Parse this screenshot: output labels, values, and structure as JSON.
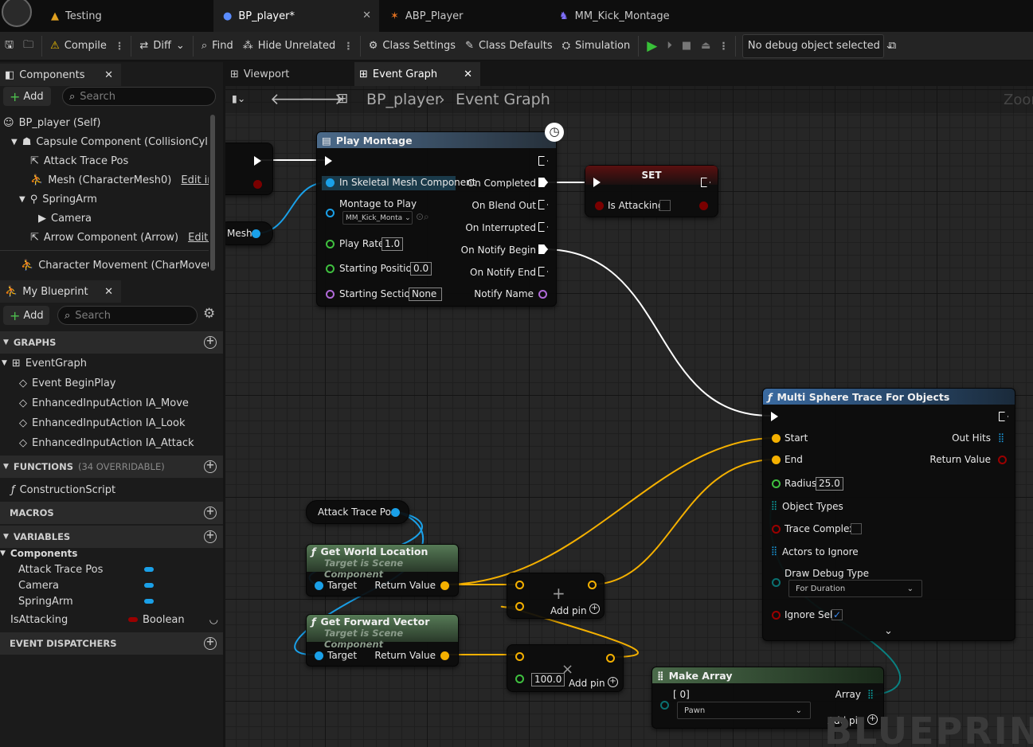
{
  "tabs": [
    {
      "label": "Testing"
    },
    {
      "label": "BP_player*"
    },
    {
      "label": "ABP_Player"
    },
    {
      "label": "MM_Kick_Montage"
    }
  ],
  "toolbar": {
    "compile": "Compile",
    "diff": "Diff",
    "find": "Find",
    "hide_unrelated": "Hide Unrelated",
    "class_settings": "Class Settings",
    "class_defaults": "Class Defaults",
    "simulation": "Simulation",
    "debug_select": "No debug object selected"
  },
  "components_panel": {
    "title": "Components",
    "add": "Add",
    "search_placeholder": "Search",
    "items": [
      {
        "label": "BP_player (Self)"
      },
      {
        "label": "Capsule Component (CollisionCylinde"
      },
      {
        "label": "Attack Trace Pos"
      },
      {
        "label": "Mesh (CharacterMesh0)",
        "link": "Edit in C+"
      },
      {
        "label": "SpringArm"
      },
      {
        "label": "Camera"
      },
      {
        "label": "Arrow Component (Arrow)",
        "link": "Edit in C"
      },
      {
        "label": "Character Movement (CharMoveCon"
      }
    ]
  },
  "blueprint_panel": {
    "title": "My Blueprint",
    "add": "Add",
    "search_placeholder": "Search",
    "graphs_header": "GRAPHS",
    "event_graph": "EventGraph",
    "events": [
      "Event BeginPlay",
      "EnhancedInputAction IA_Move",
      "EnhancedInputAction IA_Look",
      "EnhancedInputAction IA_Attack"
    ],
    "functions_header": "FUNCTIONS",
    "functions_count": "(34 OVERRIDABLE)",
    "construction": "ConstructionScript",
    "macros_header": "MACROS",
    "variables_header": "VARIABLES",
    "components_group": "Components",
    "component_vars": [
      "Attack Trace Pos",
      "Camera",
      "SpringArm"
    ],
    "is_attacking": "IsAttacking",
    "bool_type": "Boolean",
    "dispatchers_header": "EVENT DISPATCHERS"
  },
  "graph_tabs": {
    "viewport": "Viewport",
    "event_graph": "Event Graph"
  },
  "breadcrumb": {
    "blueprint": "BP_player",
    "graph": "Event Graph",
    "zoom": "Zoom"
  },
  "nodes": {
    "play_montage": {
      "title": "Play Montage",
      "in_mesh": "In Skeletal Mesh Component",
      "montage_label": "Montage to Play",
      "montage_value": "MM_Kick_Monta",
      "play_rate": "Play Rate",
      "play_rate_val": "1.0",
      "start_pos": "Starting Position",
      "start_pos_val": "0.0",
      "start_section": "Starting Section",
      "start_section_val": "None",
      "on_completed": "On Completed",
      "on_blend_out": "On Blend Out",
      "on_interrupted": "On Interrupted",
      "on_notify_begin": "On Notify Begin",
      "on_notify_end": "On Notify End",
      "notify_name": "Notify Name"
    },
    "set": {
      "title": "SET",
      "is_attacking": "Is Attacking"
    },
    "mesh_var": {
      "label": "Mesh"
    },
    "attack_trace_pos": {
      "label": "Attack Trace Pos"
    },
    "get_world_location": {
      "title": "Get World Location",
      "subtitle": "Target is Scene Component",
      "target": "Target",
      "return": "Return Value"
    },
    "get_forward_vector": {
      "title": "Get Forward Vector",
      "subtitle": "Target is Scene Component",
      "target": "Target",
      "return": "Return Value"
    },
    "add_node": {
      "add_pin": "Add pin",
      "symbol": "+"
    },
    "mult_node": {
      "add_pin": "Add pin",
      "symbol": "×",
      "value": "100.0"
    },
    "multi_sphere": {
      "title": "Multi Sphere Trace For Objects",
      "start": "Start",
      "end": "End",
      "radius": "Radius",
      "radius_val": "25.0",
      "object_types": "Object Types",
      "trace_complex": "Trace Complex",
      "actors_to_ignore": "Actors to Ignore",
      "draw_debug": "Draw Debug Type",
      "draw_debug_val": "For Duration",
      "ignore_self": "Ignore Self",
      "out_hits": "Out Hits",
      "return_value": "Return Value"
    },
    "make_array": {
      "title": "Make Array",
      "index": "[ 0]",
      "value": "Pawn",
      "array": "Array",
      "add_pin": "Add pin"
    }
  },
  "watermark": "BLUEPRINT"
}
